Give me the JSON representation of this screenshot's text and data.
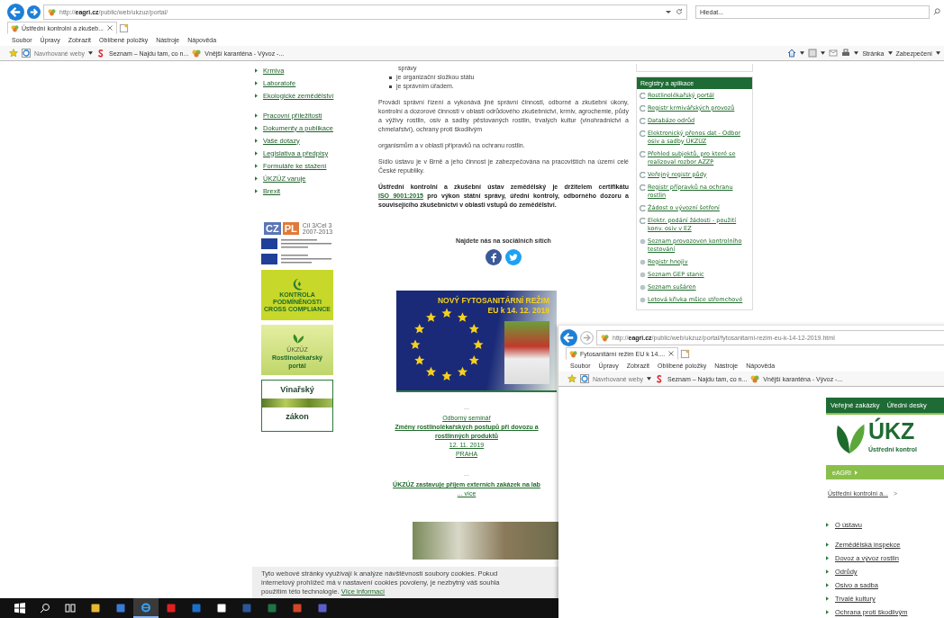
{
  "window1": {
    "address": "http://**eagri.cz**/public/web/ukzuz/portal/",
    "search_placeholder": "Hledat...",
    "tabs": [
      {
        "label": "Ústřední kontrolní a zkušeb...",
        "selected": true
      }
    ],
    "menu": [
      "Soubor",
      "Úpravy",
      "Zobrazit",
      "Oblíbené položky",
      "Nástroje",
      "Nápověda"
    ],
    "favorites": [
      "Navrhované weby",
      "Seznam – Najdu tam, co n...",
      "Vnější karanténa - Vývoz -..."
    ],
    "command_bar": [
      "Stránka",
      "Zabezpečení"
    ],
    "left_nav": [
      [
        "Krmiva",
        "Laboratoře",
        "Ekologické zemědělství"
      ],
      [
        "Pracovní příležitosti",
        "Dokumenty a publikace",
        "Vaše dotazy",
        "Legislativa a předpisy",
        "Formuláře ke stažení",
        "ÚKZÚZ varuje",
        "Brexit"
      ]
    ],
    "czpl_logo": {
      "letters": [
        "CZ",
        "PL"
      ],
      "caption": [
        "Cíl 3/Cel 3",
        "2007-2013"
      ]
    },
    "banners": [
      {
        "kind": "compliance",
        "lines": [
          "KONTROLA",
          "PODMÍNĚNOSTI",
          "CROSS COMPLIANCE"
        ]
      },
      {
        "kind": "portal",
        "lines": [
          "ÚKZÚZ",
          "Rostlinolékařský",
          "portál"
        ]
      },
      {
        "kind": "wine",
        "lines": [
          "Vinařský",
          "zákon"
        ]
      }
    ],
    "article": {
      "continuation": "správy",
      "bullets": [
        "je organizační složkou státu",
        "je správním úřadem."
      ],
      "paragraphs": [
        "Provádí správní řízení a vykonává jiné správní činnosti, odborné a zkušební úkony, kontrolní a dozorové činnosti v oblasti odrůdového zkušebnictví, krmiv, agrochemie, půdy a výživy rostlin, osiv a sadby pěstovaných rostlin, trvalých kultur (vinohradnictví a chmelařství), ochrany proti škodlivým",
        "organismům a v oblasti přípravků na ochranu rostlin.",
        "Sídlo ústavu je v Brně a jeho činnost je zabezpečována na pracovištích na území celé České republiky."
      ],
      "certification": {
        "before": "Ústřední kontrolní a zkušební ústav zemědělský je držitelem certifikátu",
        "link": "ISO 9001:2015",
        "after": "pro výkon státní správy, úřední kontroly, odborného dozoru a souvisejícího zkušebnictví v oblasti vstupů do zemědělství."
      }
    },
    "social_heading": "Najdete nás na sociálních sítích",
    "promo": {
      "title": "NOVÝ FYTOSANITÁRNÍ REŽIM",
      "subtitle": "EU k 14. 12. 2019"
    },
    "news": [
      {
        "separator": "...",
        "label": "Odborný seminář",
        "title_lines": [
          "Změny rostlinolékařských postupů při dovozu a",
          "rostlinných produktů"
        ],
        "date": "12. 11. 2019",
        "place": "PRAHA"
      },
      {
        "separator": "...",
        "title_lines": [
          "ÚKZÚZ zastavuje příjem externích zakázek na lab"
        ],
        "more": "... více"
      }
    ],
    "registry": {
      "title": "Registry a aplikace",
      "items": [
        {
          "label": "Rostlinolékařský portál",
          "kind": "app"
        },
        {
          "label": "Registr krmivářských provozů",
          "kind": "app"
        },
        {
          "label": "Databáze odrůd",
          "kind": "app"
        },
        {
          "label": "Elektronický přenos dat - Odbor osiv a sadby ÚKZÚZ",
          "kind": "app"
        },
        {
          "label": "Přehled subjektů, pro které se realizoval rozbor AZZP",
          "kind": "app"
        },
        {
          "label": "Veřejný registr půdy",
          "kind": "app"
        },
        {
          "label": "Registr přípravků na ochranu rostlin",
          "kind": "app"
        },
        {
          "label": "Žádost o vývozní šetření",
          "kind": "app"
        },
        {
          "label": "Elektr. podání žádosti - použití konv. osiv v EZ",
          "kind": "app"
        },
        {
          "label": "Seznam provozoven kontrolního testování",
          "kind": "list"
        },
        {
          "label": "Registr hnojiv",
          "kind": "list"
        },
        {
          "label": "Seznam GEP stanic",
          "kind": "list"
        },
        {
          "label": "Seznam sušáren",
          "kind": "list"
        },
        {
          "label": "Letová křivka mšice střemchové",
          "kind": "list"
        }
      ]
    },
    "cookie": {
      "lines": [
        "Tyto webové stránky využívají k analýze návštěvnosti soubory cookies. Pokud",
        "internetový prohlížeč má v nastavení cookies povoleny, je nezbytný váš souhla",
        "použitím této technologie."
      ],
      "link": "Více informací"
    }
  },
  "window2": {
    "address": "http://**eagri.cz**/public/web/ukzuz/portal/fytosanitarni-rezim-eu-k-14-12-2019.html",
    "tabs": [
      {
        "label": "Fytosanitární režim EU k 14....",
        "selected": true
      }
    ],
    "menu": [
      "Soubor",
      "Úpravy",
      "Zobrazit",
      "Oblíbené položky",
      "Nástroje",
      "Nápověda"
    ],
    "favorites": [
      "Navrhované weby",
      "Seznam – Najdu tam, co n...",
      "Vnější karanténa - Vývoz -..."
    ],
    "top_links": [
      "Veřejné zakázky",
      "Úřední desky"
    ],
    "logo": "ÚKZ",
    "logo_subtitle": "Ústřední kontrol",
    "portal_bar": "eAGRI",
    "breadcrumb": {
      "link": "Ústřední kontrolní a...",
      "separator": ">"
    },
    "nav": [
      [
        "O ústavu"
      ],
      [
        "Zemědělská inspekce",
        "Dovoz a vývoz rostlin",
        "Odrůdy",
        "Osivo a sadba",
        "Trvalé kultury",
        "Ochrana proti škodlivým"
      ]
    ]
  },
  "taskbar": [
    {
      "kind": "start",
      "selected": false
    },
    {
      "kind": "search",
      "selected": false
    },
    {
      "kind": "taskview",
      "selected": false
    },
    {
      "kind": "explorer",
      "selected": false
    },
    {
      "kind": "store",
      "selected": false
    },
    {
      "kind": "ie",
      "selected": true
    },
    {
      "kind": "grid",
      "selected": false
    },
    {
      "kind": "mail",
      "selected": false
    },
    {
      "kind": "file",
      "selected": false
    },
    {
      "kind": "doc",
      "selected": false
    },
    {
      "kind": "sheet",
      "selected": false
    },
    {
      "kind": "slides",
      "selected": false
    },
    {
      "kind": "chat",
      "selected": false
    }
  ]
}
